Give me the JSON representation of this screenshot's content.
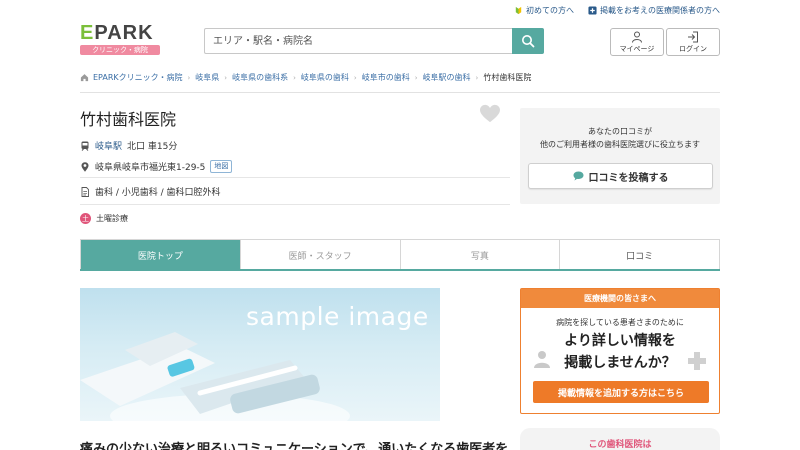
{
  "toplinks": {
    "first_time": "初めての方へ",
    "medical": "掲載をお考えの医療関係者の方へ"
  },
  "logo": {
    "main_e": "E",
    "main_rest": "PARK",
    "sub": "クリニック・病院"
  },
  "search": {
    "placeholder": "エリア・駅名・病院名"
  },
  "header": {
    "mypage": "マイページ",
    "login": "ログイン"
  },
  "breadcrumb": [
    "EPARKクリニック・病院",
    "岐阜県",
    "岐阜県の歯科系",
    "岐阜県の歯科",
    "岐阜市の歯科",
    "岐阜駅の歯科",
    "竹村歯科医院"
  ],
  "clinic": {
    "name": "竹村歯科医院",
    "station": "岐阜駅",
    "access": "北口 車15分",
    "address": "岐阜県岐阜市福光東1-29-5",
    "map_label": "地図",
    "departments": "歯科 / 小児歯科 / 歯科口腔外科",
    "saturday_label": "土曜診療",
    "saturday_icon_text": "土"
  },
  "review": {
    "line1": "あなたの口コミが",
    "line2": "他のご利用者様の歯科医院選びに役立ちます",
    "button": "口コミを投稿する"
  },
  "tabs": [
    "医院トップ",
    "医師・スタッフ",
    "写真",
    "口コミ"
  ],
  "sample_image": {
    "text": "sample image"
  },
  "headline": "痛みの少ない治療と明るいコミュニケーションで、通いたくなる歯医者を目指",
  "medical_box": {
    "head": "医療機関の皆さまへ",
    "sub": "病院を探している患者さまのために",
    "big1": "より詳しい情報を",
    "big2": "掲載しませんか？",
    "button": "掲載情報を追加する方はこちら"
  },
  "bottom_box": {
    "text": "この歯科医院は"
  },
  "colors": {
    "teal": "#56a9a0",
    "orange": "#f08a3c",
    "pink": "#e0557a",
    "link": "#3a6ea5"
  }
}
